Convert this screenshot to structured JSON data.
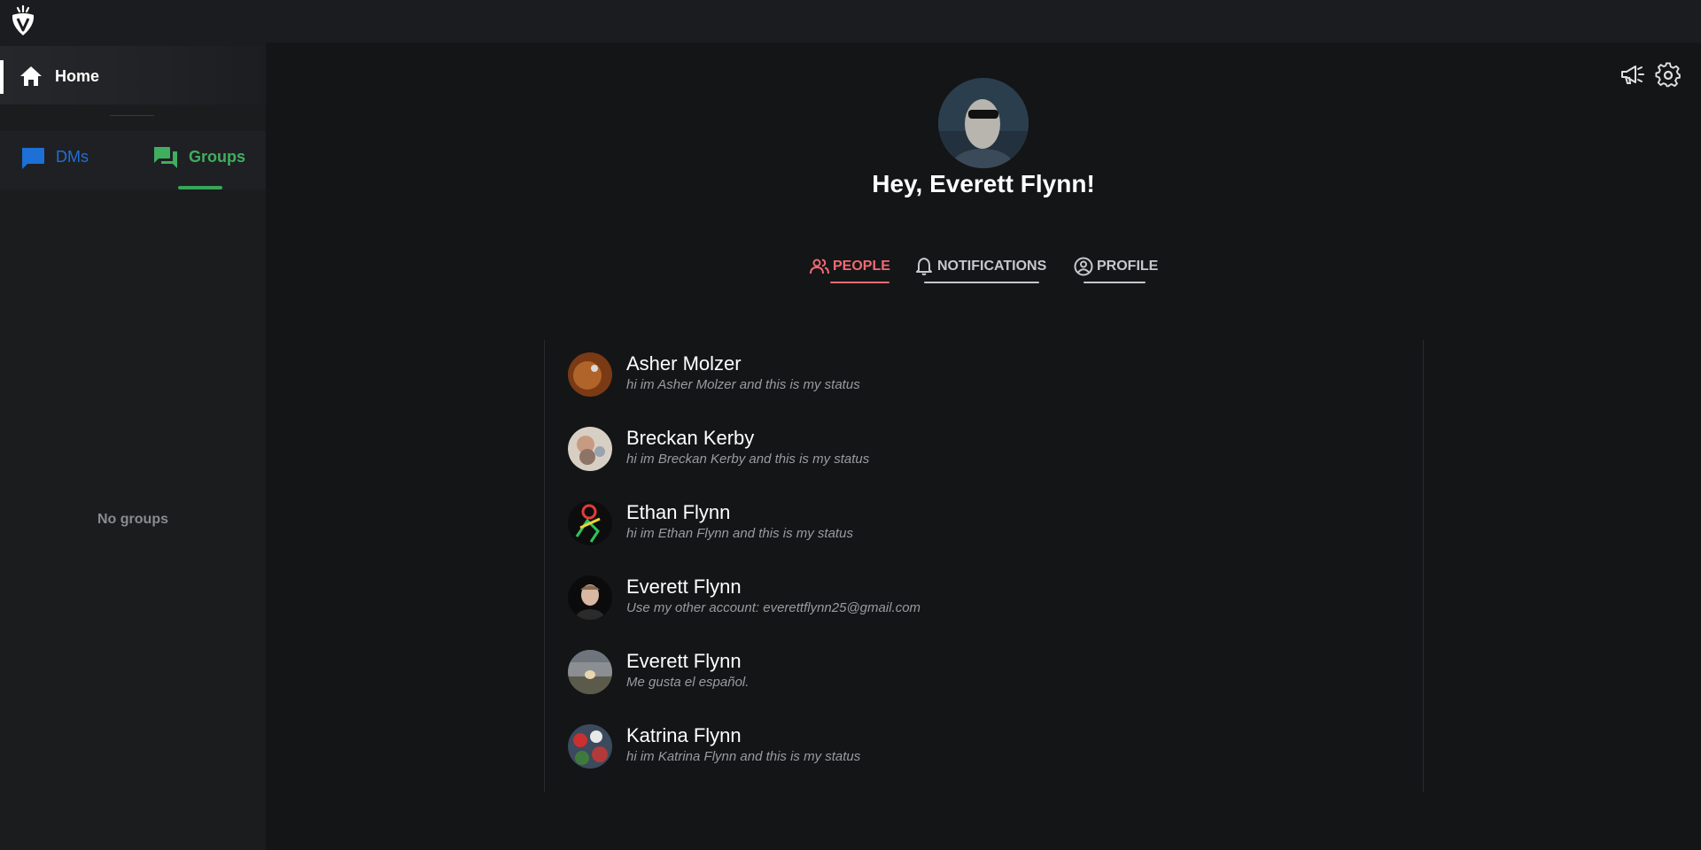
{
  "app": {
    "logo_icon": "strawberry-logo-icon"
  },
  "sidebar": {
    "home_label": "Home",
    "home_icon": "home-icon",
    "switch": [
      {
        "label": "DMs",
        "icon": "chat-bubble-icon",
        "color": "#1e6fd6"
      },
      {
        "label": "Groups",
        "icon": "group-chat-icon",
        "color": "#3fae5f",
        "active": true
      }
    ],
    "empty_text": "No groups"
  },
  "header_actions": [
    {
      "icon": "megaphone-icon"
    },
    {
      "icon": "gear-icon"
    }
  ],
  "main": {
    "greeting": "Hey, Everett Flynn!",
    "tabs": [
      {
        "label": "PEOPLE",
        "icon": "people-icon",
        "active": true,
        "color": "#f06a72"
      },
      {
        "label": "NOTIFICATIONS",
        "icon": "bell-icon",
        "active": false
      },
      {
        "label": "PROFILE",
        "icon": "user-circle-icon",
        "active": false
      }
    ],
    "people": [
      {
        "name": "Asher Molzer",
        "status": "hi im Asher Molzer and this is my status"
      },
      {
        "name": "Breckan Kerby",
        "status": "hi im Breckan Kerby and this is my status"
      },
      {
        "name": "Ethan Flynn",
        "status": "hi im Ethan Flynn and this is my status"
      },
      {
        "name": "Everett Flynn",
        "status": "Use my other account: everettflynn25@gmail.com"
      },
      {
        "name": "Everett Flynn",
        "status": "Me gusta el español."
      },
      {
        "name": "Katrina Flynn",
        "status": "hi im Katrina Flynn and this is my status"
      }
    ]
  },
  "colors": {
    "accent_people": "#f06a72",
    "dm_blue": "#1e6fd6",
    "groups_green": "#3fae5f",
    "background": "#141517",
    "sidebar": "#1b1c1e"
  }
}
